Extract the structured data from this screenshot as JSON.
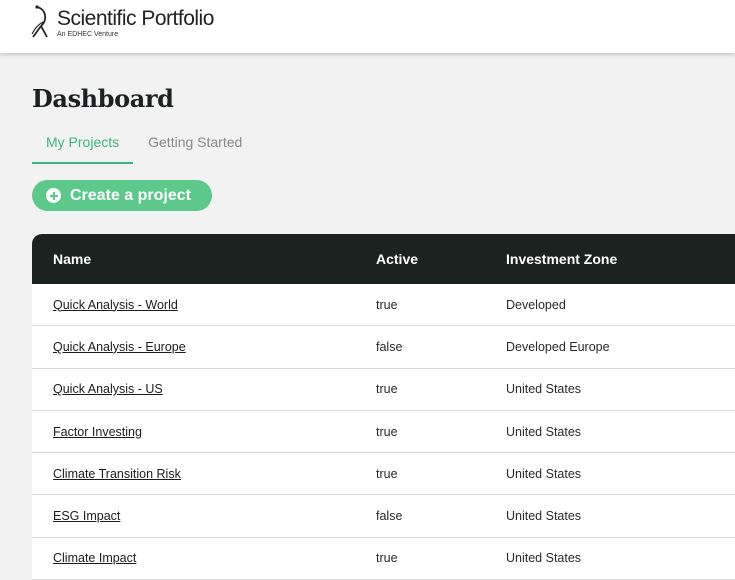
{
  "brand": {
    "name": "Scientific Portfolio",
    "tagline": "An EDHEC Venture"
  },
  "page": {
    "title": "Dashboard"
  },
  "tabs": [
    {
      "label": "My Projects",
      "active": true
    },
    {
      "label": "Getting Started",
      "active": false
    }
  ],
  "create_button": {
    "label": "Create a project",
    "icon": "plus-circle-icon"
  },
  "table": {
    "columns": [
      "Name",
      "Active",
      "Investment Zone"
    ],
    "rows": [
      {
        "name": "Quick Analysis - World",
        "active": "true",
        "zone": "Developed"
      },
      {
        "name": "Quick Analysis - Europe",
        "active": "false",
        "zone": "Developed Europe"
      },
      {
        "name": "Quick Analysis - US",
        "active": "true",
        "zone": "United States"
      },
      {
        "name": "Factor Investing",
        "active": "true",
        "zone": "United States"
      },
      {
        "name": "Climate Transition Risk",
        "active": "true",
        "zone": "United States"
      },
      {
        "name": "ESG Impact",
        "active": "false",
        "zone": "United States"
      },
      {
        "name": "Climate Impact",
        "active": "true",
        "zone": "United States"
      }
    ]
  },
  "colors": {
    "accent": "#3db67a",
    "button": "#5cc98a",
    "table_header": "#1b2220",
    "background": "#f2f2f2"
  }
}
